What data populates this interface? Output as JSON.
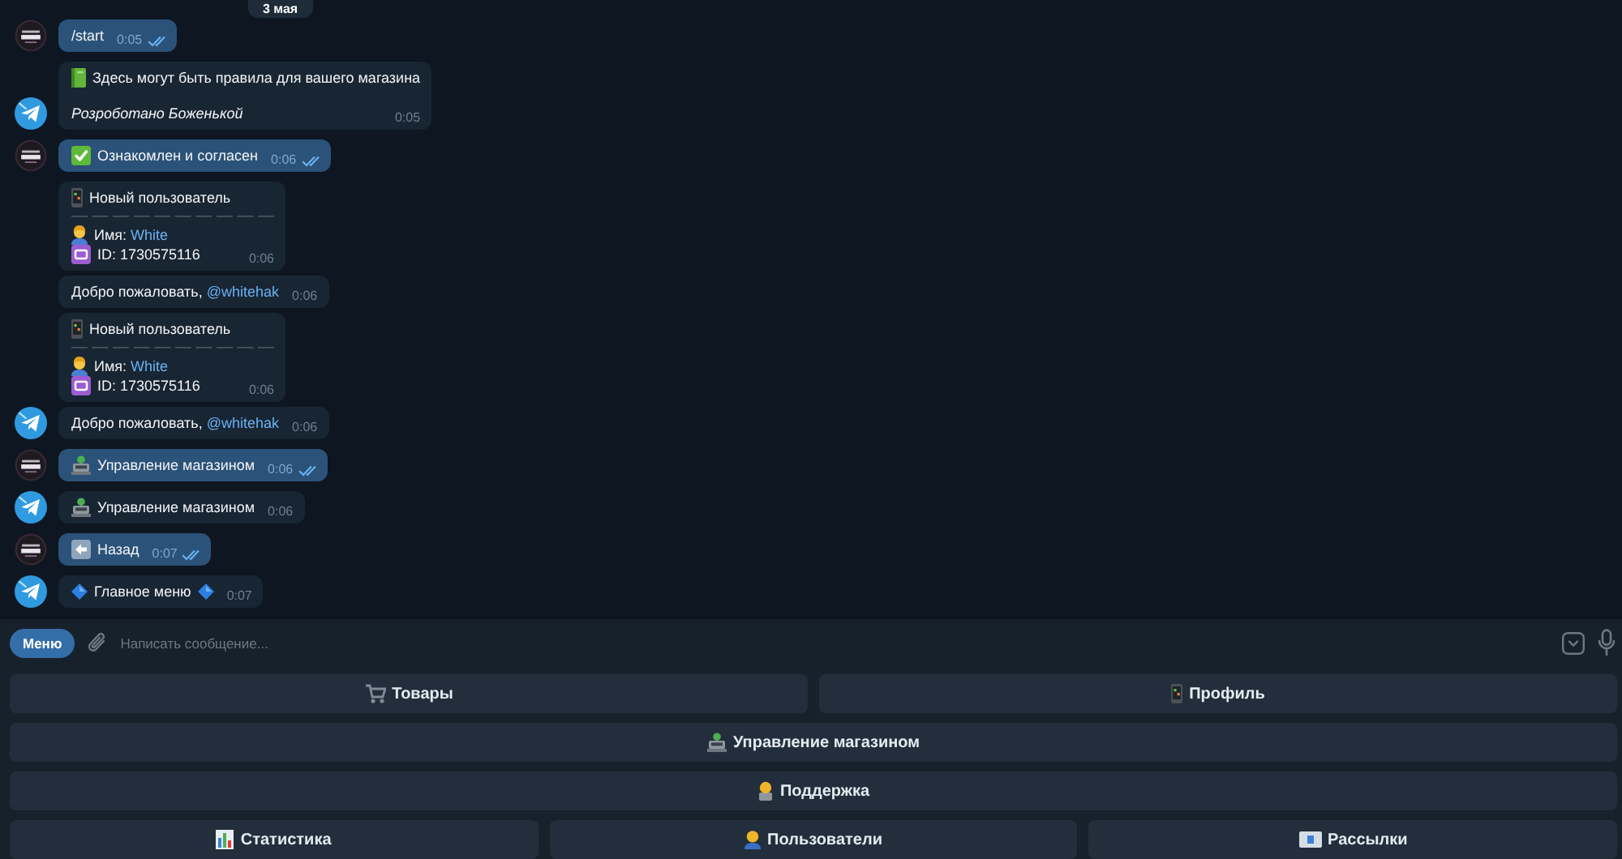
{
  "chat": {
    "date": "3 мая",
    "messages": [
      {
        "kind": "text",
        "outgoing": true,
        "avatar": true,
        "text": "/start",
        "time": "0:05",
        "read": true
      },
      {
        "kind": "rules",
        "outgoing": false,
        "avatar": true,
        "text": "Здесь могут быть правила для вашего магазина",
        "signature": "Розроботано Боженькой",
        "time": "0:05"
      },
      {
        "kind": "text",
        "outgoing": true,
        "avatar": true,
        "text": "Ознакомлен и согласен",
        "time": "0:06",
        "read": true
      },
      {
        "kind": "new_user",
        "outgoing": false,
        "avatar": false,
        "title": "Новый пользователь",
        "divider": "— — — — — — — — — —",
        "name_label": "Имя:",
        "name": "White",
        "user_id": "ID: 1730575116",
        "time": "0:06"
      },
      {
        "kind": "text",
        "outgoing": false,
        "avatar": false,
        "text": "Добро пожаловать,",
        "mention": "@whitehak",
        "time": "0:06"
      },
      {
        "kind": "new_user",
        "outgoing": false,
        "avatar": false,
        "title": "Новый пользователь",
        "divider": "— — — — — — — — — —",
        "name_label": "Имя:",
        "name": "White",
        "user_id": "ID: 1730575116",
        "time": "0:06"
      },
      {
        "kind": "text",
        "outgoing": false,
        "avatar": true,
        "text": "Добро пожаловать,",
        "mention": "@whitehak",
        "time": "0:06"
      },
      {
        "kind": "text",
        "outgoing": true,
        "avatar": true,
        "text": "Управление магазином",
        "time": "0:06",
        "read": true
      },
      {
        "kind": "text",
        "outgoing": false,
        "avatar": true,
        "text": "Управление магазином",
        "time": "0:06"
      },
      {
        "kind": "text",
        "outgoing": true,
        "avatar": true,
        "text": "Назад",
        "time": "0:07",
        "read": true
      },
      {
        "kind": "text",
        "outgoing": false,
        "avatar": true,
        "text": "Главное меню",
        "time": "0:07"
      }
    ]
  },
  "composer": {
    "menu_button": "Меню",
    "placeholder": "Написать сообщение..."
  },
  "keyboard": [
    {
      "buttons": [
        "Товары",
        "Профиль"
      ]
    },
    {
      "buttons": [
        "Управление магазином"
      ]
    },
    {
      "buttons": [
        "Поддержка"
      ]
    },
    {
      "buttons": [
        "Статистика",
        "Пользователи",
        "Рассылки"
      ]
    }
  ]
}
